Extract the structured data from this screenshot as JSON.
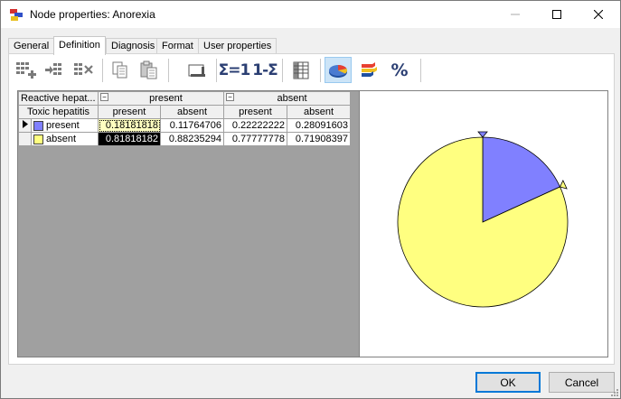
{
  "window": {
    "title": "Node properties: Anorexia"
  },
  "tabs": [
    {
      "label": "General"
    },
    {
      "label": "Definition"
    },
    {
      "label": "Diagnosis"
    },
    {
      "label": "Format"
    },
    {
      "label": "User properties"
    }
  ],
  "toolbar": {
    "sum_label": "Σ=1",
    "complement_label": "1-Σ",
    "percent_label": "%"
  },
  "table": {
    "parent1_label": "Reactive hepat...",
    "parent1_states": [
      "present",
      "absent"
    ],
    "parent2_label": "Toxic hepatitis",
    "parent2_states": [
      "present",
      "absent",
      "present",
      "absent"
    ],
    "rows": [
      {
        "state": "present",
        "color": "#8080ff",
        "values": [
          "0.18181818",
          "0.11764706",
          "0.22222222",
          "0.28091603"
        ]
      },
      {
        "state": "absent",
        "color": "#ffff80",
        "values": [
          "0.81818182",
          "0.88235294",
          "0.77777778",
          "0.71908397"
        ]
      }
    ]
  },
  "chart_data": {
    "type": "pie",
    "slices": [
      {
        "state": "present",
        "value": 0.18181818,
        "color": "#8080ff"
      },
      {
        "state": "absent",
        "value": 0.81818182,
        "color": "#ffff80"
      }
    ]
  },
  "buttons": {
    "ok": "OK",
    "cancel": "Cancel"
  }
}
